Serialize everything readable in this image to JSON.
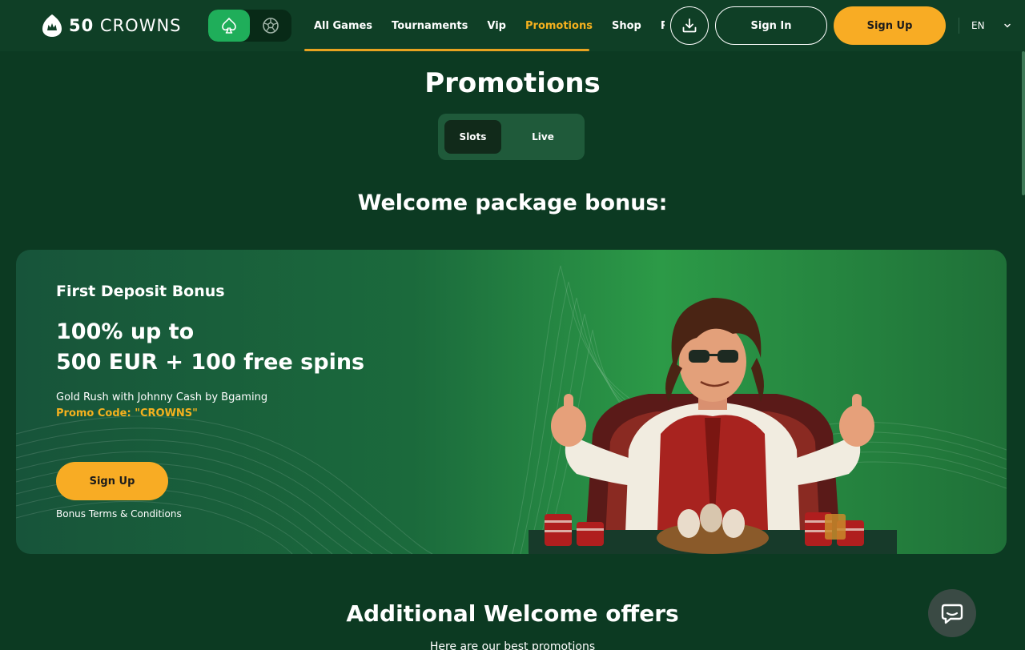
{
  "header": {
    "logo_number": "50",
    "logo_text": "CROWNS",
    "mode_toggle": [
      {
        "icon": "spade-icon",
        "active": true
      },
      {
        "icon": "soccer-ball-icon",
        "active": false
      }
    ],
    "nav": [
      {
        "label": "All Games",
        "active": false
      },
      {
        "label": "Tournaments",
        "active": false
      },
      {
        "label": "Vip",
        "active": false
      },
      {
        "label": "Promotions",
        "active": true
      },
      {
        "label": "Shop",
        "active": false
      },
      {
        "label": "Referral",
        "active": false
      }
    ],
    "download_icon": "download-icon",
    "signin_label": "Sign In",
    "signup_label": "Sign Up",
    "language": "EN"
  },
  "page": {
    "title": "Promotions",
    "tabs": [
      {
        "label": "Slots",
        "active": true
      },
      {
        "label": "Live",
        "active": false
      }
    ],
    "section_title": "Welcome package bonus:"
  },
  "promo_card": {
    "title": "First Deposit Bonus",
    "headline_line1": "100% up to",
    "headline_line2": "500 EUR + 100 free spins",
    "game": "Gold Rush with Johnny Cash by Bgaming",
    "promo_code": "Promo Code: \"CROWNS\"",
    "signup_label": "Sign Up",
    "terms_label": "Bonus Terms & Conditions"
  },
  "additional": {
    "title": "Additional Welcome offers",
    "subtitle": "Here are our best promotions"
  },
  "colors": {
    "background": "#0c3a22",
    "header": "#0f3f26",
    "accent": "#f8ac24",
    "active_nav": "#f5b11e",
    "toggle_active": "#1fae5a"
  },
  "chat_icon": "chat-bubble-icon"
}
